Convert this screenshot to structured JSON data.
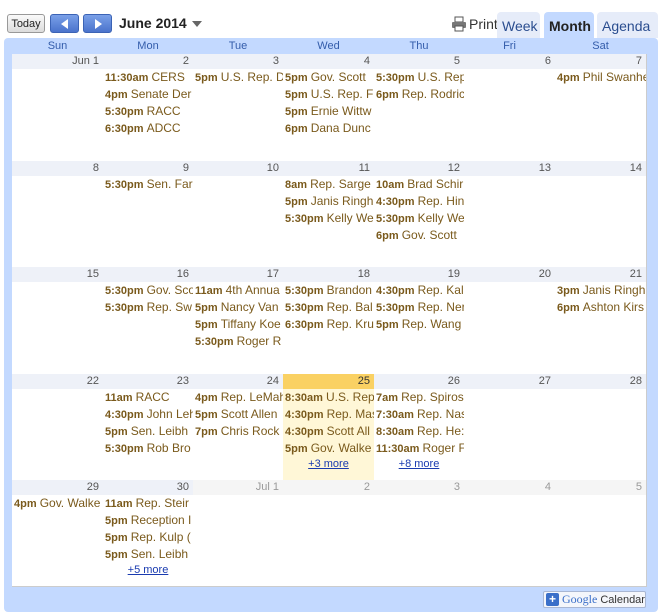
{
  "toolbar": {
    "today_label": "Today",
    "month_title": "June 2014",
    "print_label": "Print",
    "tabs": [
      {
        "label": "Week",
        "active": false
      },
      {
        "label": "Month",
        "active": true
      },
      {
        "label": "Agenda",
        "active": false
      }
    ]
  },
  "days_of_week": [
    "Sun",
    "Mon",
    "Tue",
    "Wed",
    "Thu",
    "Fri",
    "Sat"
  ],
  "weeks": [
    [
      {
        "date": "Jun 1",
        "events": []
      },
      {
        "date": "2",
        "events": [
          {
            "time": "11:30am",
            "title": "CERS"
          },
          {
            "time": "4pm",
            "title": "Senate Der"
          },
          {
            "time": "5:30pm",
            "title": "RACC"
          },
          {
            "time": "6:30pm",
            "title": "ADCC"
          }
        ]
      },
      {
        "date": "3",
        "events": [
          {
            "time": "5pm",
            "title": "U.S. Rep. D"
          }
        ]
      },
      {
        "date": "4",
        "events": [
          {
            "time": "5pm",
            "title": "Gov. Scott"
          },
          {
            "time": "5pm",
            "title": "U.S. Rep. F"
          },
          {
            "time": "5pm",
            "title": "Ernie Wittw"
          },
          {
            "time": "6pm",
            "title": "Dana Dunc"
          }
        ]
      },
      {
        "date": "5",
        "events": [
          {
            "time": "5:30pm",
            "title": "U.S. Rep"
          },
          {
            "time": "6pm",
            "title": "Rep. Rodric"
          }
        ]
      },
      {
        "date": "6",
        "events": []
      },
      {
        "date": "7",
        "events": [
          {
            "time": "4pm",
            "title": "Phil Swanhe"
          }
        ]
      }
    ],
    [
      {
        "date": "8",
        "events": []
      },
      {
        "date": "9",
        "events": [
          {
            "time": "5:30pm",
            "title": "Sen. Far"
          }
        ]
      },
      {
        "date": "10",
        "events": []
      },
      {
        "date": "11",
        "events": [
          {
            "time": "8am",
            "title": "Rep. Sarge"
          },
          {
            "time": "5pm",
            "title": "Janis Ringh"
          },
          {
            "time": "5:30pm",
            "title": "Kelly We"
          }
        ]
      },
      {
        "date": "12",
        "events": [
          {
            "time": "10am",
            "title": "Brad Schir"
          },
          {
            "time": "4:30pm",
            "title": "Rep. Hin"
          },
          {
            "time": "5:30pm",
            "title": "Kelly We"
          },
          {
            "time": "6pm",
            "title": "Gov. Scott"
          }
        ]
      },
      {
        "date": "13",
        "events": []
      },
      {
        "date": "14",
        "events": []
      }
    ],
    [
      {
        "date": "15",
        "events": []
      },
      {
        "date": "16",
        "events": [
          {
            "time": "5:30pm",
            "title": "Gov. Sco"
          },
          {
            "time": "5:30pm",
            "title": "Rep. Sw"
          }
        ]
      },
      {
        "date": "17",
        "events": [
          {
            "time": "11am",
            "title": "4th Annua"
          },
          {
            "time": "5pm",
            "title": "Nancy Van"
          },
          {
            "time": "5pm",
            "title": "Tiffany Koe"
          },
          {
            "time": "5:30pm",
            "title": "Roger R"
          }
        ]
      },
      {
        "date": "18",
        "events": [
          {
            "time": "5:30pm",
            "title": "Brandon"
          },
          {
            "time": "5:30pm",
            "title": "Rep. Bal"
          },
          {
            "time": "6:30pm",
            "title": "Rep. Kru"
          }
        ]
      },
      {
        "date": "19",
        "events": [
          {
            "time": "4:30pm",
            "title": "Rep. Kal"
          },
          {
            "time": "5:30pm",
            "title": "Rep. Neris"
          },
          {
            "time": "5pm",
            "title": "Rep. Wang"
          }
        ]
      },
      {
        "date": "20",
        "events": []
      },
      {
        "date": "21",
        "events": [
          {
            "time": "3pm",
            "title": "Janis Ringh"
          },
          {
            "time": "6pm",
            "title": "Ashton Kirs"
          }
        ]
      }
    ],
    [
      {
        "date": "22",
        "events": []
      },
      {
        "date": "23",
        "events": [
          {
            "time": "11am",
            "title": "RACC"
          },
          {
            "time": "4:30pm",
            "title": "John Leh"
          },
          {
            "time": "5pm",
            "title": "Sen. Leibh"
          },
          {
            "time": "5:30pm",
            "title": "Rob Bro"
          }
        ]
      },
      {
        "date": "24",
        "events": [
          {
            "time": "4pm",
            "title": "Rep. LeMah"
          },
          {
            "time": "5pm",
            "title": "Scott Allen"
          },
          {
            "time": "7pm",
            "title": "Chris Rock"
          }
        ]
      },
      {
        "date": "25",
        "today": true,
        "more": "+3 more",
        "events": [
          {
            "time": "8:30am",
            "title": "U.S. Rep"
          },
          {
            "time": "4:30pm",
            "title": "Rep. Mas"
          },
          {
            "time": "4:30pm",
            "title": "Scott All"
          },
          {
            "time": "5pm",
            "title": "Gov. Walke"
          }
        ]
      },
      {
        "date": "26",
        "more": "+8 more",
        "events": [
          {
            "time": "7am",
            "title": "Rep. Spiros"
          },
          {
            "time": "7:30am",
            "title": "Rep. Nas"
          },
          {
            "time": "8:30am",
            "title": "Rep. He:"
          },
          {
            "time": "11:30am",
            "title": "Roger F"
          }
        ]
      },
      {
        "date": "27",
        "events": []
      },
      {
        "date": "28",
        "events": []
      }
    ],
    [
      {
        "date": "29",
        "events": [
          {
            "time": "4pm",
            "title": "Gov. Walke"
          }
        ]
      },
      {
        "date": "30",
        "more": "+5 more",
        "events": [
          {
            "time": "11am",
            "title": "Rep. Steir"
          },
          {
            "time": "5pm",
            "title": "Reception I"
          },
          {
            "time": "5pm",
            "title": "Rep. Kulp ("
          },
          {
            "time": "5pm",
            "title": "Sen. Leibh"
          }
        ]
      },
      {
        "date": "Jul 1",
        "other": true,
        "events": []
      },
      {
        "date": "2",
        "other": true,
        "events": []
      },
      {
        "date": "3",
        "other": true,
        "events": []
      },
      {
        "date": "4",
        "other": true,
        "events": []
      },
      {
        "date": "5",
        "other": true,
        "events": []
      }
    ]
  ],
  "badge": {
    "google": "Google",
    "calendar": "Calendar"
  },
  "icons": {
    "prev": "chevron-left-icon",
    "next": "chevron-right-icon",
    "dropdown": "triangle-down-icon",
    "print": "printer-icon",
    "badge": "plus-icon"
  },
  "colors": {
    "accent": "#c3d9ff",
    "event_text": "#7a5a1c",
    "today_head": "#fad163",
    "today_bg": "#fff7d7",
    "link": "#1a3bb0"
  }
}
